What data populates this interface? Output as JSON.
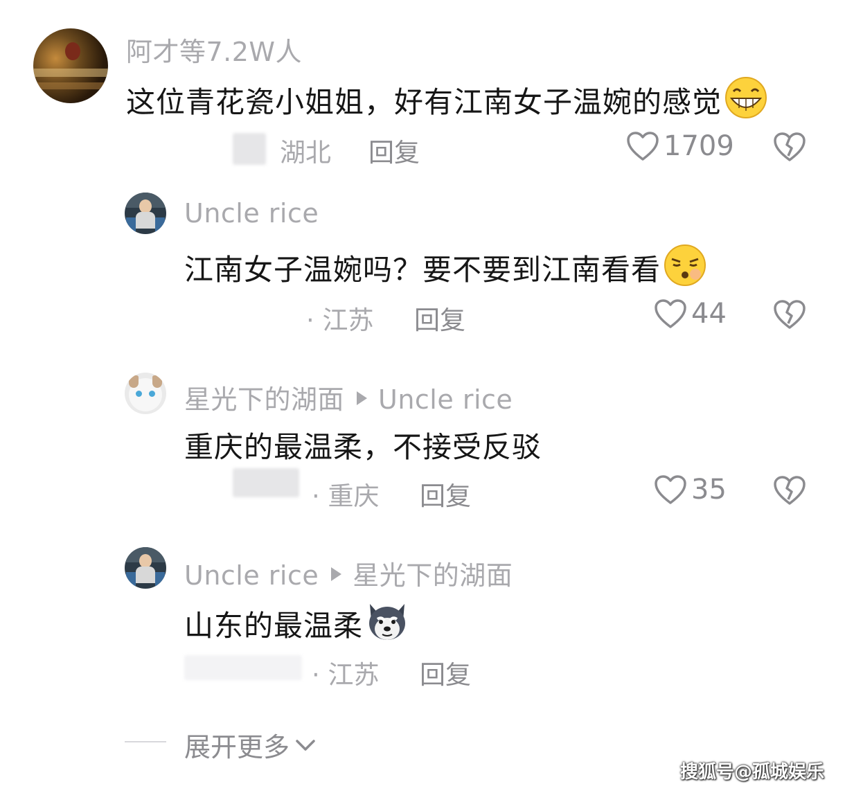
{
  "comments": [
    {
      "name": "阿才等7.2W人",
      "text": "这位青花瓷小姐姐，好有江南女子温婉的感觉",
      "emoji": "grinning-face-emoji",
      "location": "湖北",
      "reply_label": "回复",
      "likes": "1709"
    },
    {
      "name": "Uncle rice",
      "text": "江南女子温婉吗？要不要到江南看看",
      "emoji": "smirking-face-emoji",
      "location": "· 江苏",
      "reply_label": "回复",
      "likes": "44"
    },
    {
      "name": "星光下的湖面",
      "reply_to": "Uncle rice",
      "text": "重庆的最温柔，不接受反驳",
      "location": "· 重庆",
      "reply_label": "回复",
      "likes": "35"
    },
    {
      "name": "Uncle rice",
      "reply_to": "星光下的湖面",
      "text": "山东的最温柔",
      "emoji": "husky-dog-emoji",
      "location": "· 江苏",
      "reply_label": "回复"
    }
  ],
  "expand_label": "展开更多",
  "watermark": "搜狐号@孤城娱乐",
  "icons": {
    "like": "heart-outline-icon",
    "dislike": "broken-heart-icon",
    "expand": "chevron-down-icon"
  },
  "colors": {
    "meta_text": "#a9a9ad",
    "body_text": "#161616",
    "emoji_yellow": "#fdd23c"
  }
}
